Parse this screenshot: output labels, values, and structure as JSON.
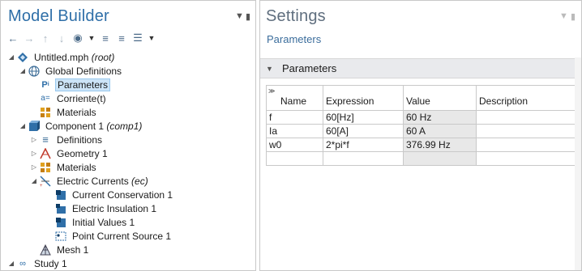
{
  "model_builder": {
    "title": "Model Builder",
    "toolbar": [
      "arrow-left-icon",
      "arrow-right-icon",
      "arrow-up-icon",
      "arrow-down-icon",
      "eye-icon",
      "dropdown-icon",
      "expand-all-icon",
      "collapse-all-icon",
      "list-icon",
      "dropdown-icon"
    ],
    "tree": [
      {
        "label": "Untitled.mph",
        "suffix": "(root)",
        "icon": "model-icon",
        "expanded": true
      },
      {
        "label": "Global Definitions",
        "suffix": "",
        "icon": "globe-icon",
        "expanded": true
      },
      {
        "label": "Parameters",
        "suffix": "",
        "icon": "pi-icon",
        "selected": true
      },
      {
        "label": "Corriente(t)",
        "suffix": "",
        "icon": "function-icon"
      },
      {
        "label": "Materials",
        "suffix": "",
        "icon": "materials-icon"
      },
      {
        "label": "Component 1",
        "suffix": "(comp1)",
        "icon": "component-icon",
        "expanded": true
      },
      {
        "label": "Definitions",
        "suffix": "",
        "icon": "definitions-icon",
        "expanded": false
      },
      {
        "label": "Geometry 1",
        "suffix": "",
        "icon": "geometry-icon",
        "expanded": false
      },
      {
        "label": "Materials",
        "suffix": "",
        "icon": "materials-icon",
        "expanded": false
      },
      {
        "label": "Electric Currents",
        "suffix": "(ec)",
        "icon": "electric-currents-icon",
        "expanded": true
      },
      {
        "label": "Current Conservation 1",
        "suffix": "",
        "icon": "domain-feature-icon"
      },
      {
        "label": "Electric Insulation 1",
        "suffix": "",
        "icon": "boundary-feature-icon"
      },
      {
        "label": "Initial Values 1",
        "suffix": "",
        "icon": "domain-feature-icon"
      },
      {
        "label": "Point Current Source 1",
        "suffix": "",
        "icon": "point-feature-icon"
      },
      {
        "label": "Mesh 1",
        "suffix": "",
        "icon": "mesh-icon"
      },
      {
        "label": "Study 1",
        "suffix": "",
        "icon": "study-icon",
        "expanded": true
      }
    ]
  },
  "settings": {
    "title": "Settings",
    "subtitle": "Parameters",
    "section": "Parameters",
    "columns": [
      "Name",
      "Expression",
      "Value",
      "Description"
    ],
    "rows": [
      {
        "name": "f",
        "expression": "60[Hz]",
        "value": "60 Hz",
        "description": ""
      },
      {
        "name": "Ia",
        "expression": "60[A]",
        "value": "60 A",
        "description": ""
      },
      {
        "name": "w0",
        "expression": "2*pi*f",
        "value": "376.99 Hz",
        "description": ""
      },
      {
        "name": "",
        "expression": "",
        "value": "",
        "description": ""
      }
    ]
  },
  "colors": {
    "title": "#2f6fa8",
    "selection": "#cce4f7",
    "section_bar": "#e9eaed"
  }
}
